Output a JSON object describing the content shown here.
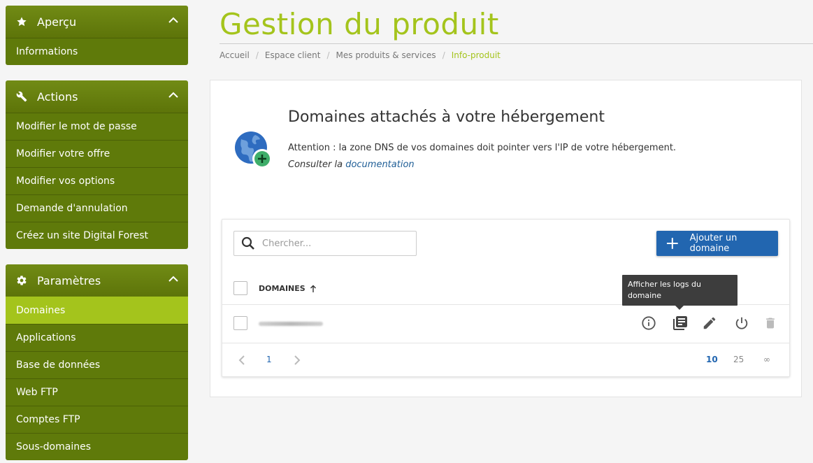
{
  "sidebar": {
    "panels": [
      {
        "title": "Aperçu",
        "icon": "star-icon",
        "items": [
          "Informations"
        ]
      },
      {
        "title": "Actions",
        "icon": "wrench-icon",
        "items": [
          "Modifier le mot de passe",
          "Modifier votre offre",
          "Modifier vos options",
          "Demande d'annulation",
          "Créez un site Digital Forest"
        ]
      },
      {
        "title": "Paramètres",
        "icon": "gear-icon",
        "items": [
          "Domaines",
          "Applications",
          "Base de données",
          "Web FTP",
          "Comptes FTP",
          "Sous-domaines"
        ],
        "active": "Domaines"
      }
    ]
  },
  "header": {
    "title": "Gestion du produit",
    "breadcrumb": [
      "Accueil",
      "Espace client",
      "Mes produits & services",
      "Info-produit"
    ],
    "breadcrumb_sep": "/"
  },
  "info": {
    "title": "Domaines attachés à votre hébergement",
    "text": "Attention : la zone DNS de vos domaines doit pointer vers l'IP de votre hébergement.",
    "doc_prefix": "Consulter la",
    "doc_link": "documentation"
  },
  "table": {
    "search_placeholder": "Chercher...",
    "add_button": "Ajouter un domaine",
    "column": "DOMAINES",
    "tooltip": "Afficher les logs du domaine",
    "pagination": {
      "current": "1",
      "sizes": [
        "10",
        "25",
        "∞"
      ],
      "active_size": "10"
    }
  },
  "colors": {
    "brand": "#a4c41c",
    "sidebar": "#5f7a0a",
    "primary": "#2266b0"
  }
}
